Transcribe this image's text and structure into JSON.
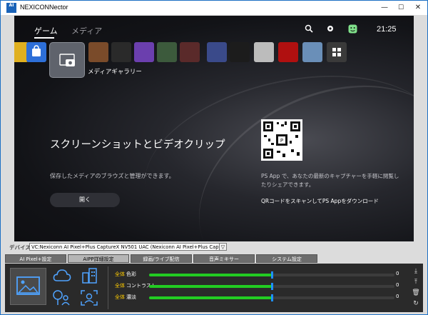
{
  "window": {
    "title": "NEXICONNector",
    "app_icon_text": "AI",
    "minimize": "—",
    "maximize": "☐",
    "close": "✕"
  },
  "ps": {
    "nav": {
      "game": "ゲーム",
      "media": "メディア"
    },
    "time": "21:25",
    "selected_tile_label": "メディアギャラリー",
    "hero_title": "スクリーンショットとビデオクリップ",
    "hero_desc": "保存したメディアのブラウズと管理ができます。",
    "open_button": "開く",
    "qr_desc": "PS App で、あなたの最新のキャプチャーを手軽に閲覧したりシェアできます。",
    "qr_link": "QRコードをスキャンしてPS Appをダウンロード",
    "tile_colors": [
      "#2d6fd8",
      "#7a4b2a",
      "#2a2a2a",
      "#6b3fae",
      "#3c5a3c",
      "#5a2a2a",
      "#3a4a8a",
      "#1c1c1c",
      "#dddddd",
      "#b11",
      "#6a8fb8",
      "#3a3a3a"
    ]
  },
  "device": {
    "label": "デバイス",
    "selected": "VC:Nexiconn AI Pixel+Plus CaptureX NV501 UAC (Nexiconn AI Pixel+Plus CaptureX NV501 UAC)"
  },
  "tabs": [
    "AI Pixel+設定",
    "AIPP詳細設定",
    "録画/ライブ配信",
    "音声ミキサー",
    "システム設定"
  ],
  "sliders": [
    {
      "all": "全体",
      "name": "色彩",
      "value": "0",
      "level": 0.5
    },
    {
      "all": "全体",
      "name": "コントラスト",
      "value": "0",
      "level": 0.5
    },
    {
      "all": "全体",
      "name": "濃淡",
      "value": "0",
      "level": 0.5
    }
  ]
}
